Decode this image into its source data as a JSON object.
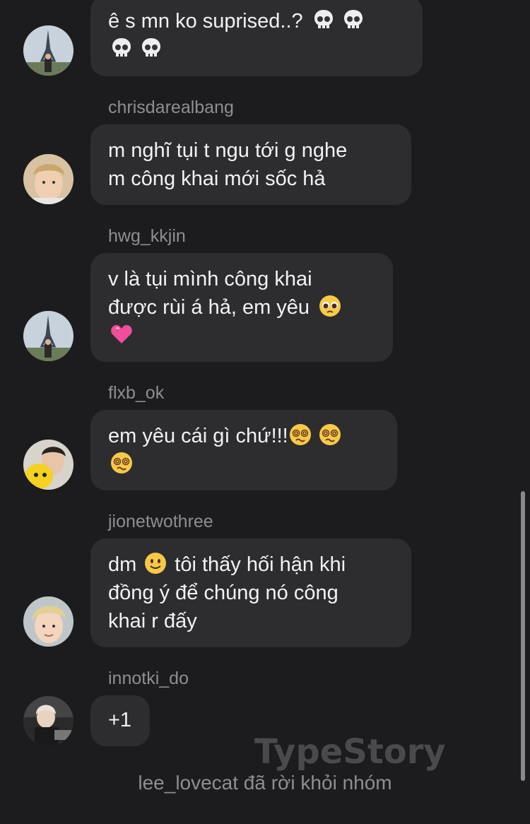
{
  "messages": [
    {
      "sender": "",
      "lines": [
        "ê s mn ko suprised..?"
      ],
      "avatar": "eiffel-tower-photo"
    },
    {
      "sender": "chrisdarealbang",
      "lines": [
        "m nghĩ tụi t ngu tới g nghe",
        "m công khai mới sốc hả"
      ],
      "avatar": "blond-person-photo"
    },
    {
      "sender": "hwg_kkjin",
      "lines": [
        "v là tụi mình công khai",
        "được rùi á hả, em yêu"
      ],
      "avatar": "eiffel-tower-photo"
    },
    {
      "sender": "flxb_ok",
      "lines": [
        "em yêu cái gì chứ!!!"
      ],
      "avatar": "person-with-yellow-plush-photo"
    },
    {
      "sender": "jionetwothree",
      "lines": [
        "dm",
        "tôi thấy hối hận khi",
        "đồng ý để chúng nó công",
        "khai r đấy"
      ],
      "avatar": "blond-person-photo"
    },
    {
      "sender": "innotki_do",
      "lines": [
        "+1"
      ],
      "avatar": "person-at-desk-photo"
    }
  ],
  "emojis": {
    "skull": "skull-icon",
    "pleading": "pleading-face-icon",
    "pink_heart": "pink-heart-icon",
    "dizzy": "face-with-spiral-eyes-icon",
    "slight_smile": "slightly-smiling-face-icon"
  },
  "watermark": "TypeStory",
  "system_message": "lee_lovecat đã rời khỏi nhóm",
  "colors": {
    "background": "#1c1c1e",
    "bubble": "#2d2d30",
    "text": "#f2f2f2",
    "sender_text": "#8e8e93"
  }
}
